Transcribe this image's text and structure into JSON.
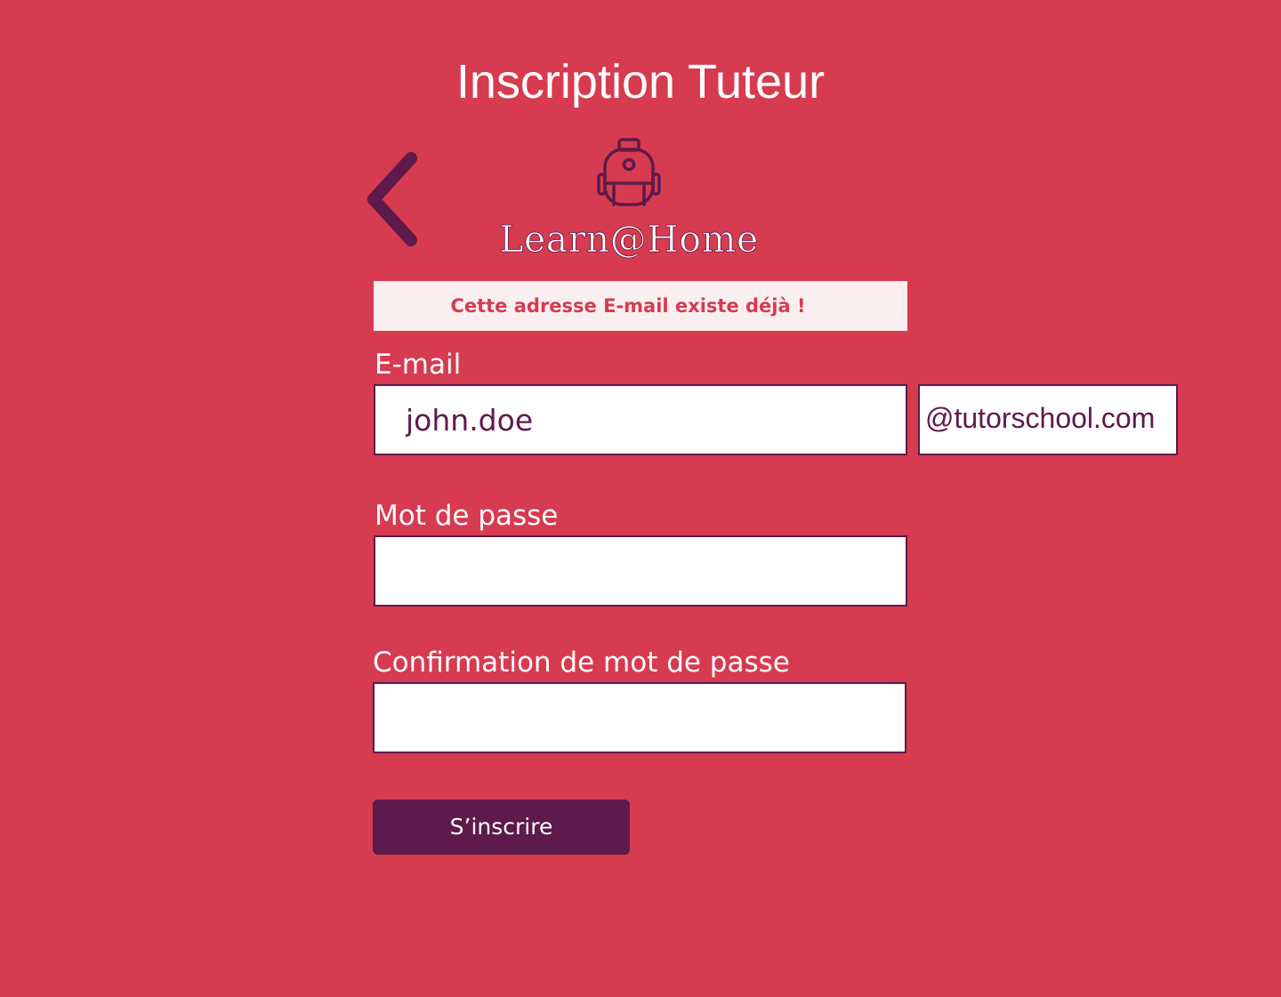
{
  "header": {
    "title": "Inscription Tuteur",
    "back_icon": "chevron-left-icon"
  },
  "logo": {
    "icon": "backpack-icon",
    "text": "Learn@Home"
  },
  "alert": {
    "message": "Cette adresse E-mail existe déjà !"
  },
  "form": {
    "email": {
      "label": "E-mail",
      "value": "john.doe",
      "domain": "@tutorschool.com"
    },
    "password": {
      "label": "Mot de passe",
      "value": ""
    },
    "password_confirm": {
      "label": "Confirmation de mot de passe",
      "value": ""
    },
    "submit_label": "S’inscrire"
  },
  "colors": {
    "background": "#d63b4f",
    "accent": "#5e1a4a",
    "alert_bg": "#f9eef0",
    "text_light": "#ffffff"
  }
}
